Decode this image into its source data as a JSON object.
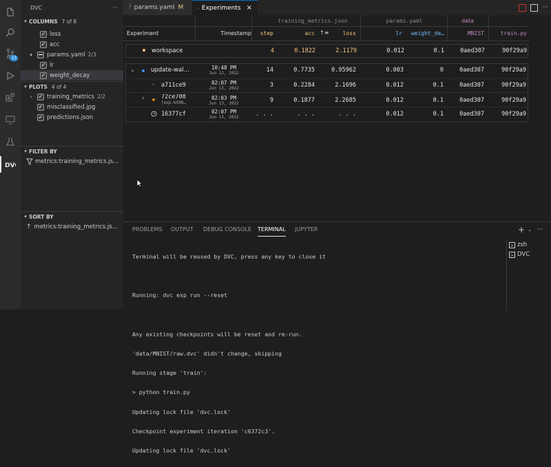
{
  "sidebar": {
    "title": "DVC",
    "more": "···",
    "columns": {
      "title": "COLUMNS",
      "count": "7 of 8",
      "items": [
        {
          "label": "loss",
          "checked": true
        },
        {
          "label": "acc",
          "checked": true
        },
        {
          "label": "params.yaml",
          "count": "2/3",
          "mixed": true
        },
        {
          "label": "lr",
          "checked": true
        },
        {
          "label": "weight_decay",
          "checked": true
        }
      ]
    },
    "plots": {
      "title": "PLOTS",
      "count": "4 of 4",
      "items": [
        {
          "label": "training_metrics",
          "count": "2/2"
        },
        {
          "label": "misclassified.jpg"
        },
        {
          "label": "predictions.json"
        }
      ]
    },
    "filter": {
      "title": "FILTER BY",
      "item": "metrics:training_metrics.js..."
    },
    "sort": {
      "title": "SORT BY",
      "item": "metrics:training_metrics.js..."
    }
  },
  "activity": {
    "badge": "13"
  },
  "tabs": [
    {
      "label": "params.yaml",
      "modified": "M"
    },
    {
      "label": "Experiments",
      "close": "×"
    }
  ],
  "grid": {
    "groups": {
      "metrics": "training_metrics.json",
      "params": "params.yaml",
      "data": "data"
    },
    "headers": {
      "experiment": "Experiment",
      "timestamp": "Timestamp",
      "step": "step",
      "acc": "acc",
      "loss": "loss",
      "lr": "lr",
      "weight_decay": "weight_de…",
      "mnist": "MNIST",
      "train": "train.py"
    },
    "workspace": {
      "name": "workspace",
      "step": "4",
      "acc": "0.1822",
      "loss": "2.1179",
      "lr": "0.012",
      "wd": "0.1",
      "mnist": "0aed307",
      "train": "90f29a9"
    },
    "rows": [
      {
        "name": "update-wal…",
        "time": "10:48 PM",
        "date": "Jun 12, 2022",
        "step": "14",
        "acc": "0.7735",
        "loss": "0.95962",
        "lr": "0.003",
        "wd": "0",
        "mnist": "0aed307",
        "train": "90f29a9"
      },
      {
        "name": "a711ce9",
        "time": "02:07 PM",
        "date": "Jun 13, 2022",
        "step": "3",
        "acc": "0.2284",
        "loss": "2.1696",
        "lr": "0.012",
        "wd": "0.1",
        "mnist": "0aed307",
        "train": "90f29a9"
      },
      {
        "name": "72ce708",
        "sub": "[exp-b598…",
        "time": "02:03 PM",
        "date": "Jun 13, 2022",
        "step": "9",
        "acc": "0.1877",
        "loss": "2.2685",
        "lr": "0.012",
        "wd": "0.1",
        "mnist": "0aed307",
        "train": "90f29a9"
      },
      {
        "name": "16377cf",
        "time": "02:07 PM",
        "date": "Jun 13, 2022",
        "step": ". . .",
        "acc": ". . .",
        "loss": ". . .",
        "lr": "0.012",
        "wd": "0.1",
        "mnist": "0aed307",
        "train": "90f29a9"
      }
    ]
  },
  "panel": {
    "tabs": [
      "PROBLEMS",
      "OUTPUT",
      "DEBUG CONSOLE",
      "TERMINAL",
      "JUPYTER"
    ],
    "terminal_lines": [
      "Terminal will be reused by DVC, press any key to close it",
      "",
      "Running: dvc exp run --reset",
      "",
      "Any existing checkpoints will be reset and re-run.",
      "'data/MNIST/raw.dvc' didn't change, skipping",
      "Running stage 'train':",
      "> python train.py",
      "Updating lock file 'dvc.lock'",
      "Checkpoint experiment iteration 'c6372c3'.",
      "Updating lock file 'dvc.lock'"
    ],
    "terminals": [
      "zsh",
      "DVC"
    ]
  },
  "colors": {
    "accent": "#0e70c0",
    "orange": "#f5c57a",
    "purple": "#c586c0",
    "blue": "#75beff"
  }
}
